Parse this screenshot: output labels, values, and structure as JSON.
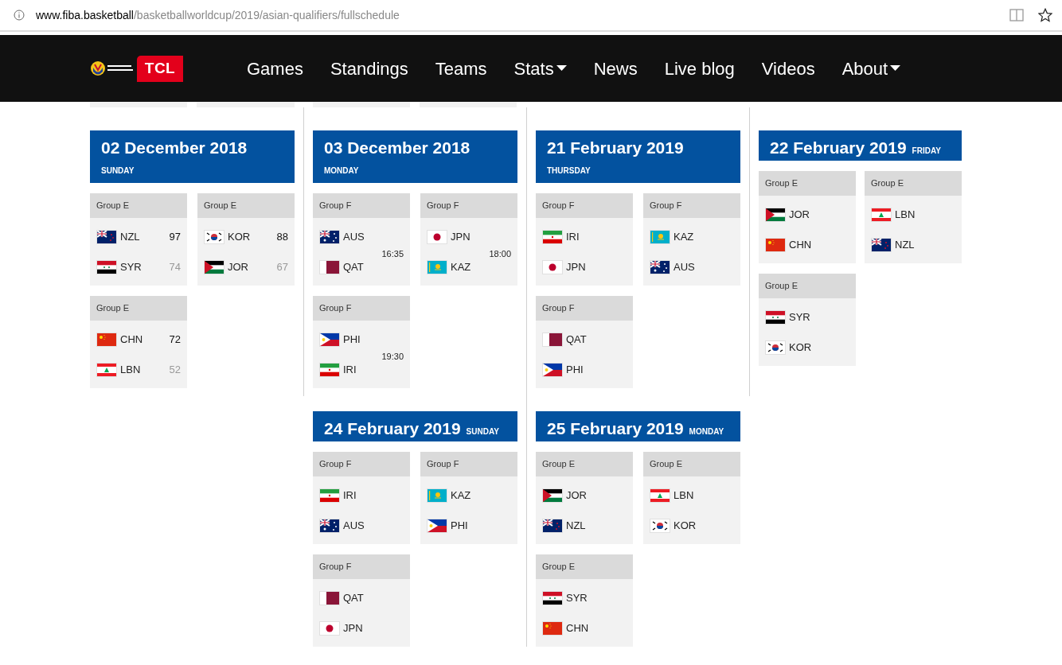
{
  "browser": {
    "url_host": "www.fiba.basketball",
    "url_path": "/basketballworldcup/2019/asian-qualifiers/fullschedule"
  },
  "nav": {
    "sponsor": "TCL",
    "items": [
      {
        "label": "Games",
        "dropdown": false
      },
      {
        "label": "Standings",
        "dropdown": false
      },
      {
        "label": "Teams",
        "dropdown": false
      },
      {
        "label": "Stats",
        "dropdown": true
      },
      {
        "label": "News",
        "dropdown": false
      },
      {
        "label": "Live blog",
        "dropdown": false
      },
      {
        "label": "Videos",
        "dropdown": false
      },
      {
        "label": "About",
        "dropdown": true
      }
    ]
  },
  "schedule_rows": [
    {
      "days": [
        {
          "date": "02 December 2018",
          "weekday": "SUNDAY",
          "kind": "stacked",
          "games": [
            {
              "group": "Group E",
              "teams": [
                {
                  "kind": "nzl",
                  "code": "NZL",
                  "score": "97",
                  "winner": true
                },
                {
                  "kind": "syr",
                  "code": "SYR",
                  "score": "74",
                  "winner": false
                }
              ]
            },
            {
              "group": "Group E",
              "teams": [
                {
                  "kind": "kor",
                  "code": "KOR",
                  "score": "88",
                  "winner": true
                },
                {
                  "kind": "jor",
                  "code": "JOR",
                  "score": "67",
                  "winner": false
                }
              ]
            },
            {
              "group": "Group E",
              "teams": [
                {
                  "kind": "chn",
                  "code": "CHN",
                  "score": "72",
                  "winner": true
                },
                {
                  "kind": "lbn",
                  "code": "LBN",
                  "score": "52",
                  "winner": false
                }
              ]
            }
          ]
        },
        {
          "date": "03 December 2018",
          "weekday": "MONDAY",
          "kind": "stacked",
          "games": [
            {
              "group": "Group F",
              "time": "16:35",
              "teams": [
                {
                  "kind": "aus",
                  "code": "AUS"
                },
                {
                  "kind": "qat",
                  "code": "QAT"
                }
              ]
            },
            {
              "group": "Group F",
              "time": "18:00",
              "teams": [
                {
                  "kind": "jpn",
                  "code": "JPN"
                },
                {
                  "kind": "kaz",
                  "code": "KAZ"
                }
              ]
            },
            {
              "group": "Group F",
              "time": "19:30",
              "teams": [
                {
                  "kind": "phi",
                  "code": "PHI"
                },
                {
                  "kind": "iri",
                  "code": "IRI"
                }
              ]
            }
          ]
        },
        {
          "date": "21 February 2019",
          "weekday": "THURSDAY",
          "kind": "stacked",
          "games": [
            {
              "group": "Group F",
              "teams": [
                {
                  "kind": "iri",
                  "code": "IRI"
                },
                {
                  "kind": "jpn",
                  "code": "JPN"
                }
              ]
            },
            {
              "group": "Group F",
              "teams": [
                {
                  "kind": "kaz",
                  "code": "KAZ"
                },
                {
                  "kind": "aus",
                  "code": "AUS"
                }
              ]
            },
            {
              "group": "Group F",
              "teams": [
                {
                  "kind": "qat",
                  "code": "QAT"
                },
                {
                  "kind": "phi",
                  "code": "PHI"
                }
              ]
            }
          ]
        },
        {
          "date": "22 February 2019",
          "weekday": "FRIDAY",
          "kind": "inline",
          "games": [
            {
              "group": "Group E",
              "teams": [
                {
                  "kind": "jor",
                  "code": "JOR"
                },
                {
                  "kind": "chn",
                  "code": "CHN"
                }
              ]
            },
            {
              "group": "Group E",
              "teams": [
                {
                  "kind": "lbn",
                  "code": "LBN"
                },
                {
                  "kind": "nzl",
                  "code": "NZL"
                }
              ]
            },
            {
              "group": "Group E",
              "teams": [
                {
                  "kind": "syr",
                  "code": "SYR"
                },
                {
                  "kind": "kor",
                  "code": "KOR"
                }
              ]
            }
          ]
        }
      ]
    },
    {
      "days": [
        {
          "date": "24 February 2019",
          "weekday": "SUNDAY",
          "kind": "inline",
          "games": [
            {
              "group": "Group F",
              "teams": [
                {
                  "kind": "iri",
                  "code": "IRI"
                },
                {
                  "kind": "aus",
                  "code": "AUS"
                }
              ]
            },
            {
              "group": "Group F",
              "teams": [
                {
                  "kind": "kaz",
                  "code": "KAZ"
                },
                {
                  "kind": "phi",
                  "code": "PHI"
                }
              ]
            },
            {
              "group": "Group F",
              "teams": [
                {
                  "kind": "qat",
                  "code": "QAT"
                },
                {
                  "kind": "jpn",
                  "code": "JPN"
                }
              ]
            }
          ]
        },
        {
          "date": "25 February 2019",
          "weekday": "MONDAY",
          "kind": "inline",
          "games": [
            {
              "group": "Group E",
              "teams": [
                {
                  "kind": "jor",
                  "code": "JOR"
                },
                {
                  "kind": "nzl",
                  "code": "NZL"
                }
              ]
            },
            {
              "group": "Group E",
              "teams": [
                {
                  "kind": "lbn",
                  "code": "LBN"
                },
                {
                  "kind": "kor",
                  "code": "KOR"
                }
              ]
            },
            {
              "group": "Group E",
              "teams": [
                {
                  "kind": "syr",
                  "code": "SYR"
                },
                {
                  "kind": "chn",
                  "code": "CHN"
                }
              ]
            }
          ]
        }
      ]
    }
  ]
}
